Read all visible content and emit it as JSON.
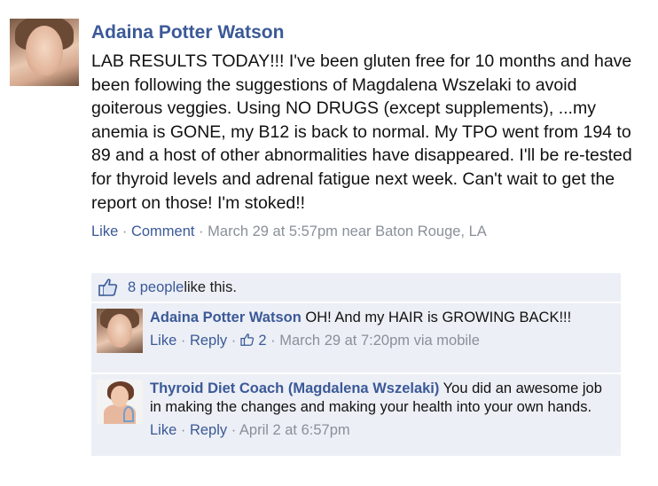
{
  "post": {
    "author": "Adaina Potter Watson",
    "text": "LAB RESULTS TODAY!!! I've been gluten free for 10 months and have been following the suggestions of Magdalena Wszelaki to avoid goiterous veggies. Using NO DRUGS (except supplements), ...my anemia is GONE, my B12 is back to normal. My TPO went from 194 to 89 and a host of other abnormalities have disappeared. I'll be re-tested for thyroid levels and adrenal fatigue next week. Can't wait to get the report on those! I'm stoked!!",
    "like_label": "Like",
    "comment_label": "Comment",
    "timestamp": "March 29 at 5:57pm near Baton Rouge, LA"
  },
  "likes": {
    "count_text": "8 people",
    "suffix": " like this."
  },
  "comments": [
    {
      "author": "Adaina Potter Watson",
      "text": " OH! And my HAIR is GROWING BACK!!!",
      "like_label": "Like",
      "reply_label": "Reply",
      "like_count": "2",
      "timestamp": "March 29 at 7:20pm via mobile"
    },
    {
      "author": "Thyroid Diet Coach (Magdalena Wszelaki)",
      "text": " You did an awesome job in making the changes and making your health into your own hands.",
      "like_label": "Like",
      "reply_label": "Reply",
      "timestamp": "April 2 at 6:57pm"
    }
  ],
  "colors": {
    "link": "#3b5998",
    "meta": "#8a8f99",
    "comment_bg": "#eceff5"
  },
  "icons": [
    "thumbs-up-icon"
  ]
}
